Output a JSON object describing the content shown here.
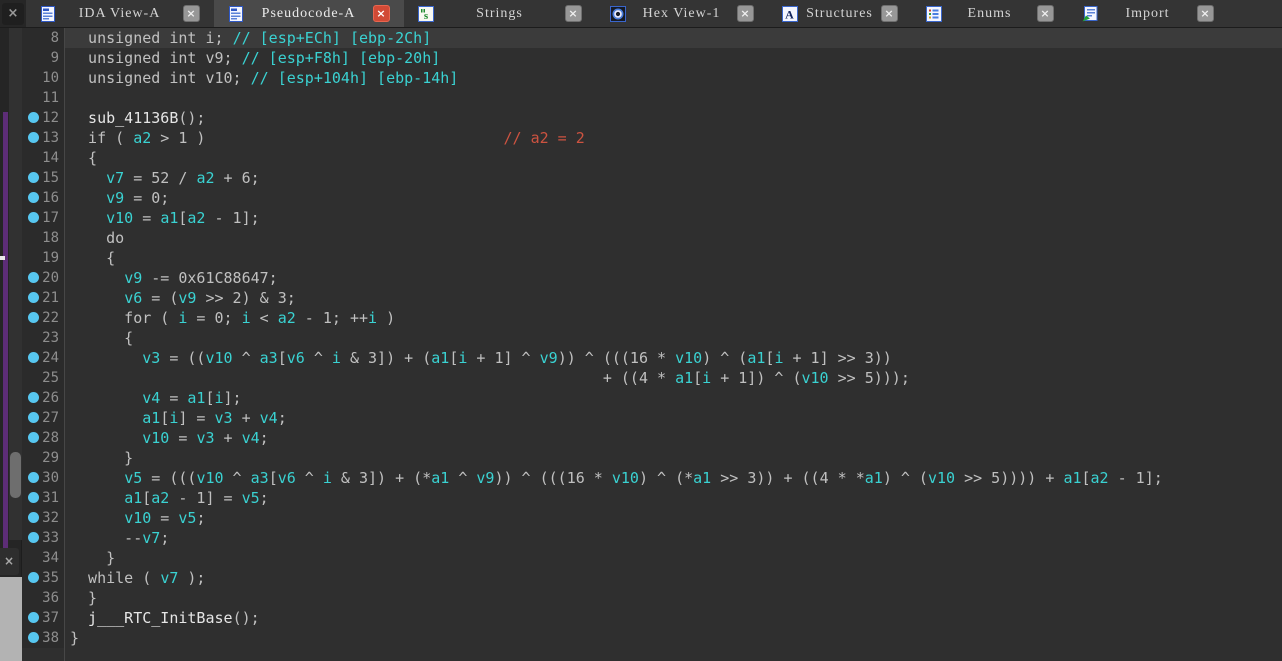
{
  "tabbar": {
    "panel_close_glyph": "×",
    "tabs": [
      {
        "label": "IDA View-A",
        "icon": "ida-view-icon",
        "active": false,
        "close_glyph": "×"
      },
      {
        "label": "Pseudocode-A",
        "icon": "pseudocode-icon",
        "active": true,
        "close_glyph": "×"
      },
      {
        "label": "Strings",
        "icon": "strings-icon",
        "active": false,
        "close_glyph": "×"
      },
      {
        "label": "Hex View-1",
        "icon": "hex-view-icon",
        "active": false,
        "close_glyph": "×"
      },
      {
        "label": "Structures",
        "icon": "structures-icon",
        "active": false,
        "close_glyph": "×"
      },
      {
        "label": "Enums",
        "icon": "enums-icon",
        "active": false,
        "close_glyph": "×"
      },
      {
        "label": "Import",
        "icon": "imports-icon",
        "active": false,
        "close_glyph": "×"
      }
    ]
  },
  "left_panel": {
    "close_glyph": "×"
  },
  "colors": {
    "code_background": "#2f2f2f",
    "current_line_background": "#3b3b3b",
    "code_default": "#c0c0c0",
    "code_variable": "#3ad2d2",
    "code_comment": "#3ad2d2",
    "code_user_comment": "#cd5340",
    "code_function": "#e6e6e6",
    "line_number": "#8e8e8e",
    "breakpoint": "#57c7f0"
  },
  "pseudocode": {
    "first_line_number": 8,
    "last_line_number": 38,
    "lines": [
      {
        "n": 8,
        "bp": false,
        "hl": true,
        "segments": [
          {
            "c": "d",
            "t": "  unsigned int i; "
          },
          {
            "c": "c",
            "t": "// [esp+ECh] [ebp-2Ch]"
          }
        ]
      },
      {
        "n": 9,
        "bp": false,
        "hl": false,
        "segments": [
          {
            "c": "d",
            "t": "  unsigned int v9; "
          },
          {
            "c": "c",
            "t": "// [esp+F8h] [ebp-20h]"
          }
        ]
      },
      {
        "n": 10,
        "bp": false,
        "hl": false,
        "segments": [
          {
            "c": "d",
            "t": "  unsigned int v10; "
          },
          {
            "c": "c",
            "t": "// [esp+104h] [ebp-14h]"
          }
        ]
      },
      {
        "n": 11,
        "bp": false,
        "hl": false,
        "segments": []
      },
      {
        "n": 12,
        "bp": true,
        "hl": false,
        "segments": [
          {
            "c": "f",
            "t": "  sub_41136B"
          },
          {
            "c": "d",
            "t": "();"
          }
        ]
      },
      {
        "n": 13,
        "bp": true,
        "hl": false,
        "segments": [
          {
            "c": "d",
            "t": "  if ( "
          },
          {
            "c": "v",
            "t": "a2"
          },
          {
            "c": "d",
            "t": " > 1 )"
          },
          {
            "c": "d",
            "t": "                                 "
          },
          {
            "c": "u",
            "t": "// a2 = 2"
          }
        ]
      },
      {
        "n": 14,
        "bp": false,
        "hl": false,
        "segments": [
          {
            "c": "d",
            "t": "  {"
          }
        ]
      },
      {
        "n": 15,
        "bp": true,
        "hl": false,
        "segments": [
          {
            "c": "d",
            "t": "    "
          },
          {
            "c": "v",
            "t": "v7"
          },
          {
            "c": "d",
            "t": " = 52 / "
          },
          {
            "c": "v",
            "t": "a2"
          },
          {
            "c": "d",
            "t": " + 6;"
          }
        ]
      },
      {
        "n": 16,
        "bp": true,
        "hl": false,
        "segments": [
          {
            "c": "d",
            "t": "    "
          },
          {
            "c": "v",
            "t": "v9"
          },
          {
            "c": "d",
            "t": " = 0;"
          }
        ]
      },
      {
        "n": 17,
        "bp": true,
        "hl": false,
        "segments": [
          {
            "c": "d",
            "t": "    "
          },
          {
            "c": "v",
            "t": "v10"
          },
          {
            "c": "d",
            "t": " = "
          },
          {
            "c": "v",
            "t": "a1"
          },
          {
            "c": "d",
            "t": "["
          },
          {
            "c": "v",
            "t": "a2"
          },
          {
            "c": "d",
            "t": " - 1];"
          }
        ]
      },
      {
        "n": 18,
        "bp": false,
        "hl": false,
        "segments": [
          {
            "c": "d",
            "t": "    do"
          }
        ]
      },
      {
        "n": 19,
        "bp": false,
        "hl": false,
        "segments": [
          {
            "c": "d",
            "t": "    {"
          }
        ]
      },
      {
        "n": 20,
        "bp": true,
        "hl": false,
        "segments": [
          {
            "c": "d",
            "t": "      "
          },
          {
            "c": "v",
            "t": "v9"
          },
          {
            "c": "d",
            "t": " -= 0x61C88647;"
          }
        ]
      },
      {
        "n": 21,
        "bp": true,
        "hl": false,
        "segments": [
          {
            "c": "d",
            "t": "      "
          },
          {
            "c": "v",
            "t": "v6"
          },
          {
            "c": "d",
            "t": " = ("
          },
          {
            "c": "v",
            "t": "v9"
          },
          {
            "c": "d",
            "t": " >> 2) & 3;"
          }
        ]
      },
      {
        "n": 22,
        "bp": true,
        "hl": false,
        "segments": [
          {
            "c": "d",
            "t": "      for ( "
          },
          {
            "c": "v",
            "t": "i"
          },
          {
            "c": "d",
            "t": " = 0; "
          },
          {
            "c": "v",
            "t": "i"
          },
          {
            "c": "d",
            "t": " < "
          },
          {
            "c": "v",
            "t": "a2"
          },
          {
            "c": "d",
            "t": " - 1; ++"
          },
          {
            "c": "v",
            "t": "i"
          },
          {
            "c": "d",
            "t": " )"
          }
        ]
      },
      {
        "n": 23,
        "bp": false,
        "hl": false,
        "segments": [
          {
            "c": "d",
            "t": "      {"
          }
        ]
      },
      {
        "n": 24,
        "bp": true,
        "hl": false,
        "segments": [
          {
            "c": "d",
            "t": "        "
          },
          {
            "c": "v",
            "t": "v3"
          },
          {
            "c": "d",
            "t": " = (("
          },
          {
            "c": "v",
            "t": "v10"
          },
          {
            "c": "d",
            "t": " ^ "
          },
          {
            "c": "v",
            "t": "a3"
          },
          {
            "c": "d",
            "t": "["
          },
          {
            "c": "v",
            "t": "v6"
          },
          {
            "c": "d",
            "t": " ^ "
          },
          {
            "c": "v",
            "t": "i"
          },
          {
            "c": "d",
            "t": " & 3]) + ("
          },
          {
            "c": "v",
            "t": "a1"
          },
          {
            "c": "d",
            "t": "["
          },
          {
            "c": "v",
            "t": "i"
          },
          {
            "c": "d",
            "t": " + 1] ^ "
          },
          {
            "c": "v",
            "t": "v9"
          },
          {
            "c": "d",
            "t": ")) ^ (((16 * "
          },
          {
            "c": "v",
            "t": "v10"
          },
          {
            "c": "d",
            "t": ") ^ ("
          },
          {
            "c": "v",
            "t": "a1"
          },
          {
            "c": "d",
            "t": "["
          },
          {
            "c": "v",
            "t": "i"
          },
          {
            "c": "d",
            "t": " + 1] >> 3))"
          }
        ]
      },
      {
        "n": 25,
        "bp": false,
        "hl": false,
        "segments": [
          {
            "c": "d",
            "t": "                                                           + ((4 * "
          },
          {
            "c": "v",
            "t": "a1"
          },
          {
            "c": "d",
            "t": "["
          },
          {
            "c": "v",
            "t": "i"
          },
          {
            "c": "d",
            "t": " + 1]) ^ ("
          },
          {
            "c": "v",
            "t": "v10"
          },
          {
            "c": "d",
            "t": " >> 5)));"
          }
        ]
      },
      {
        "n": 26,
        "bp": true,
        "hl": false,
        "segments": [
          {
            "c": "d",
            "t": "        "
          },
          {
            "c": "v",
            "t": "v4"
          },
          {
            "c": "d",
            "t": " = "
          },
          {
            "c": "v",
            "t": "a1"
          },
          {
            "c": "d",
            "t": "["
          },
          {
            "c": "v",
            "t": "i"
          },
          {
            "c": "d",
            "t": "];"
          }
        ]
      },
      {
        "n": 27,
        "bp": true,
        "hl": false,
        "segments": [
          {
            "c": "d",
            "t": "        "
          },
          {
            "c": "v",
            "t": "a1"
          },
          {
            "c": "d",
            "t": "["
          },
          {
            "c": "v",
            "t": "i"
          },
          {
            "c": "d",
            "t": "] = "
          },
          {
            "c": "v",
            "t": "v3"
          },
          {
            "c": "d",
            "t": " + "
          },
          {
            "c": "v",
            "t": "v4"
          },
          {
            "c": "d",
            "t": ";"
          }
        ]
      },
      {
        "n": 28,
        "bp": true,
        "hl": false,
        "segments": [
          {
            "c": "d",
            "t": "        "
          },
          {
            "c": "v",
            "t": "v10"
          },
          {
            "c": "d",
            "t": " = "
          },
          {
            "c": "v",
            "t": "v3"
          },
          {
            "c": "d",
            "t": " + "
          },
          {
            "c": "v",
            "t": "v4"
          },
          {
            "c": "d",
            "t": ";"
          }
        ]
      },
      {
        "n": 29,
        "bp": false,
        "hl": false,
        "segments": [
          {
            "c": "d",
            "t": "      }"
          }
        ]
      },
      {
        "n": 30,
        "bp": true,
        "hl": false,
        "segments": [
          {
            "c": "d",
            "t": "      "
          },
          {
            "c": "v",
            "t": "v5"
          },
          {
            "c": "d",
            "t": " = ((("
          },
          {
            "c": "v",
            "t": "v10"
          },
          {
            "c": "d",
            "t": " ^ "
          },
          {
            "c": "v",
            "t": "a3"
          },
          {
            "c": "d",
            "t": "["
          },
          {
            "c": "v",
            "t": "v6"
          },
          {
            "c": "d",
            "t": " ^ "
          },
          {
            "c": "v",
            "t": "i"
          },
          {
            "c": "d",
            "t": " & 3]) + (*"
          },
          {
            "c": "v",
            "t": "a1"
          },
          {
            "c": "d",
            "t": " ^ "
          },
          {
            "c": "v",
            "t": "v9"
          },
          {
            "c": "d",
            "t": ")) ^ (((16 * "
          },
          {
            "c": "v",
            "t": "v10"
          },
          {
            "c": "d",
            "t": ") ^ (*"
          },
          {
            "c": "v",
            "t": "a1"
          },
          {
            "c": "d",
            "t": " >> 3)) + ((4 * *"
          },
          {
            "c": "v",
            "t": "a1"
          },
          {
            "c": "d",
            "t": ") ^ ("
          },
          {
            "c": "v",
            "t": "v10"
          },
          {
            "c": "d",
            "t": " >> 5)))) + "
          },
          {
            "c": "v",
            "t": "a1"
          },
          {
            "c": "d",
            "t": "["
          },
          {
            "c": "v",
            "t": "a2"
          },
          {
            "c": "d",
            "t": " - 1];"
          }
        ]
      },
      {
        "n": 31,
        "bp": true,
        "hl": false,
        "segments": [
          {
            "c": "d",
            "t": "      "
          },
          {
            "c": "v",
            "t": "a1"
          },
          {
            "c": "d",
            "t": "["
          },
          {
            "c": "v",
            "t": "a2"
          },
          {
            "c": "d",
            "t": " - 1] = "
          },
          {
            "c": "v",
            "t": "v5"
          },
          {
            "c": "d",
            "t": ";"
          }
        ]
      },
      {
        "n": 32,
        "bp": true,
        "hl": false,
        "segments": [
          {
            "c": "d",
            "t": "      "
          },
          {
            "c": "v",
            "t": "v10"
          },
          {
            "c": "d",
            "t": " = "
          },
          {
            "c": "v",
            "t": "v5"
          },
          {
            "c": "d",
            "t": ";"
          }
        ]
      },
      {
        "n": 33,
        "bp": true,
        "hl": false,
        "segments": [
          {
            "c": "d",
            "t": "      --"
          },
          {
            "c": "v",
            "t": "v7"
          },
          {
            "c": "d",
            "t": ";"
          }
        ]
      },
      {
        "n": 34,
        "bp": false,
        "hl": false,
        "segments": [
          {
            "c": "d",
            "t": "    }"
          }
        ]
      },
      {
        "n": 35,
        "bp": true,
        "hl": false,
        "segments": [
          {
            "c": "d",
            "t": "  while ( "
          },
          {
            "c": "v",
            "t": "v7"
          },
          {
            "c": "d",
            "t": " );"
          }
        ]
      },
      {
        "n": 36,
        "bp": false,
        "hl": false,
        "segments": [
          {
            "c": "d",
            "t": "  }"
          }
        ]
      },
      {
        "n": 37,
        "bp": true,
        "hl": false,
        "segments": [
          {
            "c": "f",
            "t": "  j___RTC_InitBase"
          },
          {
            "c": "d",
            "t": "();"
          }
        ]
      },
      {
        "n": 38,
        "bp": true,
        "hl": false,
        "segments": [
          {
            "c": "d",
            "t": "}"
          }
        ]
      }
    ]
  }
}
